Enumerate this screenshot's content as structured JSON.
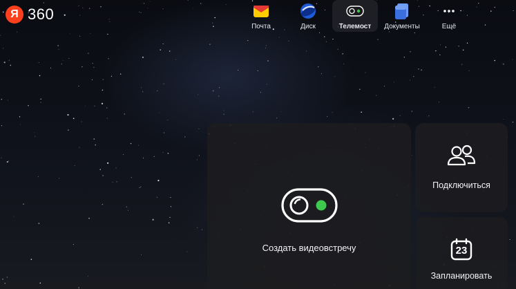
{
  "logo": {
    "mark": "Я",
    "text": "360"
  },
  "apps": [
    {
      "id": "mail",
      "label": "Почта",
      "icon": "mail-icon",
      "active": false
    },
    {
      "id": "disk",
      "label": "Диск",
      "icon": "disk-icon",
      "active": false
    },
    {
      "id": "telemost",
      "label": "Телемост",
      "icon": "telemost-icon",
      "active": true
    },
    {
      "id": "documents",
      "label": "Документы",
      "icon": "documents-icon",
      "active": false
    },
    {
      "id": "more",
      "label": "Ещё",
      "icon": "more-icon",
      "active": false
    }
  ],
  "actions": {
    "create": {
      "label": "Создать видеовстречу",
      "icon": "camera-toggle-icon"
    },
    "join": {
      "label": "Подключиться",
      "icon": "people-icon"
    },
    "schedule": {
      "label": "Запланировать",
      "icon": "calendar-icon",
      "day": "23"
    }
  },
  "colors": {
    "brand_red": "#fc3f1d",
    "mail_yellow": "#ffcc00",
    "active_green": "#3fc84e",
    "card_bg": "#1c1c20"
  }
}
